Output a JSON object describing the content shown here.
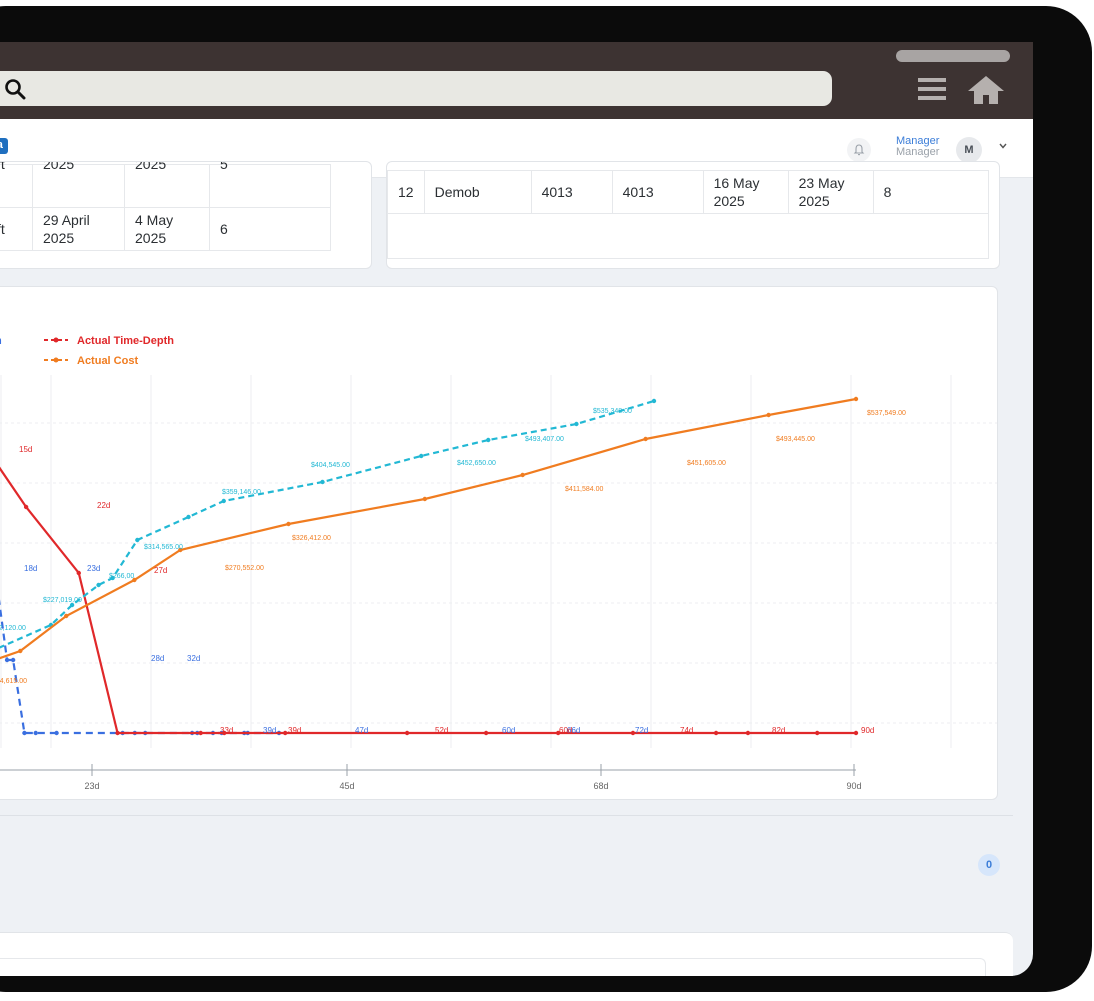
{
  "browser": {
    "search_icon": "search-icon",
    "menu_icon": "menu-icon",
    "home_icon": "home-icon"
  },
  "appbar": {
    "version_badge": "0-alpha",
    "bell_icon": "bell-icon",
    "user_name": "Manager",
    "user_role": "Manager",
    "avatar_initial": "M",
    "chevron_icon": "chevron-down-icon"
  },
  "left_table": {
    "rows": [
      {
        "depth": "4013 ft",
        "start": "2025",
        "end": "2025",
        "days": "5"
      },
      {
        "depth": "4013 ft",
        "start": "29 April 2025",
        "end": "4 May 2025",
        "days": "6"
      }
    ]
  },
  "right_table": {
    "rows": [
      {
        "no": "12",
        "phase": "Demob",
        "from": "4013",
        "to": "4013",
        "start": "16 May 2025",
        "end": "23 May 2025",
        "days": "8"
      }
    ]
  },
  "chart_data": {
    "type": "line",
    "xlabel": "Time (Days)",
    "x_ticks": [
      "23d",
      "45d",
      "68d",
      "90d"
    ],
    "legend": [
      "me-Depth",
      "Actual Time-Depth",
      "st",
      "Actual Cost"
    ],
    "colors": {
      "planned_depth": "#3a6fe0",
      "actual_depth": "#e0282a",
      "planned_cost": "#22b8d4",
      "actual_cost": "#f07c20"
    },
    "series": [
      {
        "name": "me-Depth",
        "points": [
          [
            0,
            375
          ],
          [
            10,
            375
          ],
          [
            21,
            520
          ],
          [
            25,
            520
          ],
          [
            38,
            520
          ],
          [
            53,
            617
          ],
          [
            60,
            617
          ],
          [
            73,
            690
          ],
          [
            86,
            690
          ],
          [
            110,
            690
          ],
          [
            186,
            690
          ],
          [
            200,
            690
          ],
          [
            212,
            690
          ],
          [
            266,
            690
          ],
          [
            272,
            690
          ],
          [
            290,
            690
          ],
          [
            300,
            690
          ],
          [
            326,
            690
          ],
          [
            330,
            690
          ],
          [
            366,
            690
          ]
        ],
        "labels": [
          "12d",
          "12d",
          "18d",
          "23d",
          "28d",
          "32d",
          "39d",
          "47d",
          "60d",
          "66d",
          "72d"
        ]
      },
      {
        "name": "Actual Time-Depth",
        "points": [
          [
            0,
            376
          ],
          [
            4,
            378
          ],
          [
            19,
            407
          ],
          [
            47,
            464
          ],
          [
            85,
            530
          ],
          [
            113,
            690
          ],
          [
            173,
            690
          ],
          [
            190,
            690
          ],
          [
            234,
            690
          ],
          [
            322,
            690
          ],
          [
            379,
            690
          ],
          [
            431,
            690
          ],
          [
            485,
            690
          ],
          [
            545,
            690
          ],
          [
            568,
            690
          ],
          [
            618,
            690
          ],
          [
            646,
            690
          ]
        ],
        "labels": [
          "12d",
          "15d",
          "22d",
          "27d",
          "33d",
          "39d",
          "52d",
          "60d",
          "74d",
          "82d",
          "90d"
        ]
      },
      {
        "name": "st",
        "points": [
          [
            0,
            618
          ],
          [
            20,
            606
          ],
          [
            51,
            582
          ],
          [
            63,
            562
          ],
          [
            78,
            542
          ],
          [
            86,
            535
          ],
          [
            100,
            497
          ],
          [
            129,
            474
          ],
          [
            149,
            458
          ],
          [
            205,
            439
          ],
          [
            261,
            413
          ],
          [
            299,
            397
          ],
          [
            349,
            381
          ],
          [
            393,
            358
          ]
        ],
        "labels": [
          "$227,019.00",
          "$162,120.00",
          "$266,00",
          "$314,565.00",
          "$359,146.00",
          "$404,545.00",
          "$452,650.00",
          "$493,407.00",
          "$535,348.00"
        ]
      },
      {
        "name": "Actual Cost",
        "points": [
          [
            0,
            640
          ],
          [
            13,
            622
          ],
          [
            40,
            608
          ],
          [
            71,
            573
          ],
          [
            117,
            537
          ],
          [
            148,
            507
          ],
          [
            221,
            481
          ],
          [
            313,
            456
          ],
          [
            379,
            432
          ],
          [
            462,
            396
          ],
          [
            545,
            372
          ],
          [
            604,
            356
          ]
        ],
        "labels": [
          "$84,615.00",
          "$270,552.00",
          "$326,412.00",
          "$411,584.00",
          "$451,605.00",
          "$493,445.00",
          "$537,549.00"
        ]
      }
    ]
  }
}
